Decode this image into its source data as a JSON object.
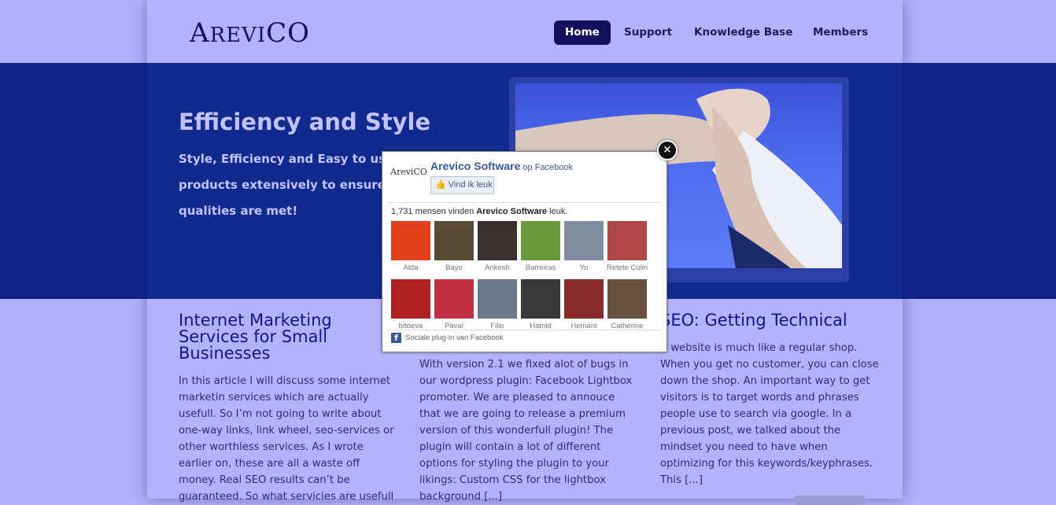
{
  "header": {
    "logo_big_a": "A",
    "logo_mid": "REVI",
    "logo_co": "CO",
    "nav": [
      {
        "label": "Home",
        "active": true
      },
      {
        "label": "Support",
        "active": false
      },
      {
        "label": "Knowledge Base",
        "active": false
      },
      {
        "label": "Members",
        "active": false
      }
    ]
  },
  "hero": {
    "title": "Efficiency and Style",
    "line1": "Style, Efficiency and Easy to use",
    "line2": "products extensively to ensure",
    "line3": "qualities are met!"
  },
  "columns": [
    {
      "title_lines": [
        "Internet Marketing",
        "Services for Small",
        "Businesses"
      ],
      "text_lines": [
        "In this article I will discuss some internet",
        "marketin services which are actually",
        "usefull. So I’m not going to write about",
        "one-way links, link wheel, seo-services or",
        "other worthless services. As I wrote",
        "earlier on, these are all a waste off",
        "money. Real SEO results can’t be",
        "guaranteed. So what servicies are usefull"
      ]
    },
    {
      "title_lines": [],
      "text_lines": [
        "With version 2.1 we fixed alot of bugs in",
        "our wordpress plugin: Facebook Lightbox",
        "promoter. We are pleased to annouce",
        "that we are going to release a premium",
        "version of this wonderfull plugin! The",
        "plugin will contain a lot of different",
        "options for styling the plugin to your",
        "likings: Custom CSS for the lightbox",
        "background [...]"
      ]
    },
    {
      "title_lines": [
        "SEO: Getting Technical"
      ],
      "text_lines": [
        "A website is much like a regular shop.",
        "When you get no customer, you can close",
        "down the shop. An important way to get",
        "visitors is to target words and phrases",
        "people use to search via google. In a",
        "previous post, we talked about the",
        "mindset you need to have when",
        "optimizing for this keywords/keyphrases.",
        "This [...]"
      ]
    }
  ],
  "lightbox": {
    "close_symbol": "×",
    "mini_logo": "AreviCO",
    "page_name": "Arevico Software",
    "page_suffix": " op Facebook",
    "like_label": "Vind ik leuk",
    "count_prefix": "1,731 mensen vinden ",
    "count_page": "Arevico Software",
    "count_suffix": " leuk.",
    "faces": [
      {
        "name": "Alda",
        "color": "#e0401a"
      },
      {
        "name": "Bayo",
        "color": "#5a4a38"
      },
      {
        "name": "Ankesh",
        "color": "#3a3030"
      },
      {
        "name": "Barreiras",
        "color": "#6a9a3a"
      },
      {
        "name": "Yo",
        "color": "#7f8fa0"
      },
      {
        "name": "Retete Culin",
        "color": "#b04848"
      },
      {
        "name": "bltgeva",
        "color": "#b02020"
      },
      {
        "name": "Payal",
        "color": "#c03040"
      },
      {
        "name": "Filip",
        "color": "#6a7a8a"
      },
      {
        "name": "Hamid",
        "color": "#3a3a3a"
      },
      {
        "name": "Hemant",
        "color": "#8a2a2a"
      },
      {
        "name": "Catherine",
        "color": "#6a5040"
      }
    ],
    "footer_icon": "f",
    "footer_text": "Sociale plug-in van Facebook"
  }
}
